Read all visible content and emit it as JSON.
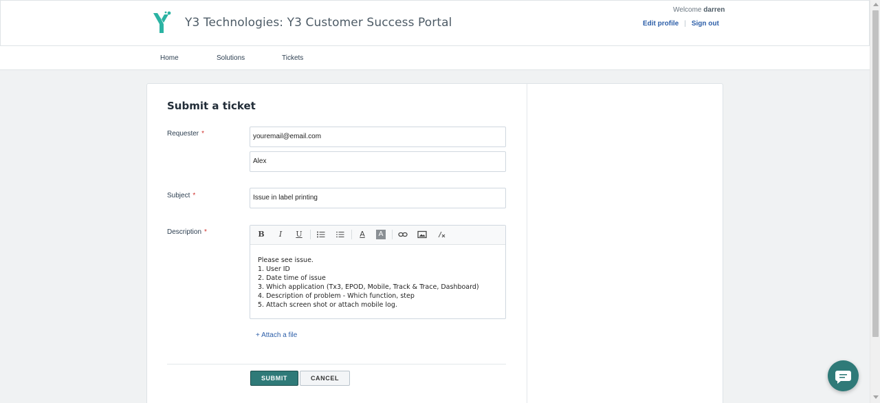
{
  "header": {
    "portal_title": "Y3 Technologies: Y3 Customer Success Portal",
    "welcome_prefix": "Welcome",
    "username": "darren",
    "edit_profile": "Edit profile",
    "sign_out": "Sign out"
  },
  "nav": {
    "items": [
      {
        "label": "Home"
      },
      {
        "label": "Solutions"
      },
      {
        "label": "Tickets"
      }
    ]
  },
  "form": {
    "title": "Submit a ticket",
    "requester_label": "Requester",
    "requester_email": "youremail@email.com",
    "requester_name": "Alex",
    "subject_label": "Subject",
    "subject_value": "Issue in label printing",
    "description_label": "Description",
    "required_marker": "*",
    "toolbar": {
      "bold": "B",
      "italic": "I",
      "underline": "U",
      "font_color": "A",
      "bg_color": "A"
    },
    "description_lines": [
      "Please see issue.",
      "1. User ID",
      "2. Date time of issue",
      "3. Which application (Tx3, EPOD, Mobile, Track & Trace, Dashboard)",
      "4. Description of problem - Which function, step",
      "5. Attach screen shot or attach mobile log."
    ],
    "attach_label": "+ Attach a file",
    "submit_label": "SUBMIT",
    "cancel_label": "CANCEL"
  },
  "colors": {
    "brand_teal": "#2f7a78",
    "logo_teal": "#2bb3a3",
    "link_blue": "#2c5ea8",
    "required_red": "#d0312d"
  },
  "icons": {
    "logo": "y3-logo-icon",
    "bullet_list": "bullet-list-icon",
    "numbered_list": "numbered-list-icon",
    "link": "link-icon",
    "image": "image-icon",
    "clear_format": "clear-format-icon",
    "chat": "chat-icon"
  }
}
